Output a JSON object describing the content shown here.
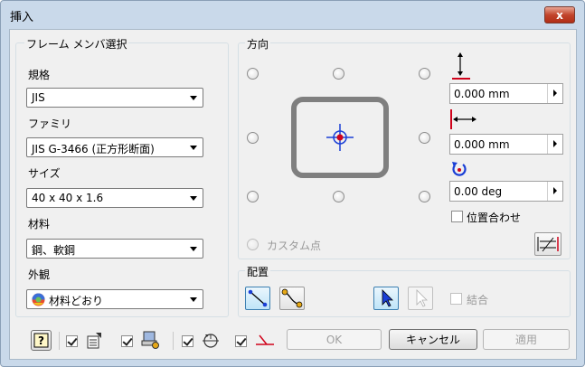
{
  "window": {
    "title": "挿入",
    "close_label": "x"
  },
  "frame_member": {
    "group_label": "フレーム メンバ選択",
    "standard_label": "規格",
    "standard_value": "JIS",
    "family_label": "ファミリ",
    "family_value": "JIS G-3466 (正方形断面)",
    "size_label": "サイズ",
    "size_value": "40 x 40 x 1.6",
    "material_label": "材料",
    "material_value": "鋼、軟鋼",
    "appearance_label": "外観",
    "appearance_value": "材料どおり"
  },
  "orientation": {
    "group_label": "方向",
    "custom_point_label": "カスタム点",
    "vertical_offset": "0.000 mm",
    "horizontal_offset": "0.000 mm",
    "rotation": "0.00 deg",
    "align_label": "位置合わせ",
    "align_checked": false
  },
  "placement": {
    "group_label": "配置",
    "merge_label": "結合",
    "merge_checked": false
  },
  "bottom_bar": {
    "checkbox1_checked": true,
    "checkbox2_checked": true,
    "checkbox3_checked": true,
    "checkbox4_checked": true
  },
  "buttons": {
    "ok": "OK",
    "cancel": "キャンセル",
    "apply": "適用"
  },
  "colors": {
    "accent_red": "#d0021b",
    "accent_blue": "#1a3fd6",
    "frame_gray": "#7f7f7f"
  }
}
